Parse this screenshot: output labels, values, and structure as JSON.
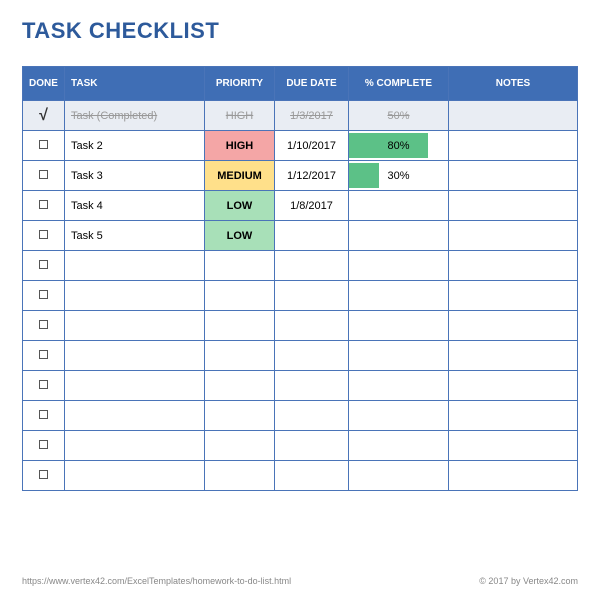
{
  "title": "TASK CHECKLIST",
  "columns": {
    "done": "DONE",
    "task": "TASK",
    "priority": "PRIORITY",
    "due": "DUE DATE",
    "complete": "% COMPLETE",
    "notes": "NOTES"
  },
  "rows": [
    {
      "done": true,
      "task": "Task (Completed)",
      "priority": "HIGH",
      "due": "1/3/2017",
      "pct": "50%",
      "pct_num": 50,
      "notes": "",
      "completed": true
    },
    {
      "done": false,
      "task": "Task 2",
      "priority": "HIGH",
      "due": "1/10/2017",
      "pct": "80%",
      "pct_num": 80,
      "notes": "",
      "completed": false
    },
    {
      "done": false,
      "task": "Task 3",
      "priority": "MEDIUM",
      "due": "1/12/2017",
      "pct": "30%",
      "pct_num": 30,
      "notes": "",
      "completed": false
    },
    {
      "done": false,
      "task": "Task 4",
      "priority": "LOW",
      "due": "1/8/2017",
      "pct": "",
      "pct_num": null,
      "notes": "",
      "completed": false
    },
    {
      "done": false,
      "task": "Task 5",
      "priority": "LOW",
      "due": "",
      "pct": "",
      "pct_num": null,
      "notes": "",
      "completed": false
    },
    {
      "done": false,
      "task": "",
      "priority": "",
      "due": "",
      "pct": "",
      "pct_num": null,
      "notes": "",
      "completed": false
    },
    {
      "done": false,
      "task": "",
      "priority": "",
      "due": "",
      "pct": "",
      "pct_num": null,
      "notes": "",
      "completed": false
    },
    {
      "done": false,
      "task": "",
      "priority": "",
      "due": "",
      "pct": "",
      "pct_num": null,
      "notes": "",
      "completed": false
    },
    {
      "done": false,
      "task": "",
      "priority": "",
      "due": "",
      "pct": "",
      "pct_num": null,
      "notes": "",
      "completed": false
    },
    {
      "done": false,
      "task": "",
      "priority": "",
      "due": "",
      "pct": "",
      "pct_num": null,
      "notes": "",
      "completed": false
    },
    {
      "done": false,
      "task": "",
      "priority": "",
      "due": "",
      "pct": "",
      "pct_num": null,
      "notes": "",
      "completed": false
    },
    {
      "done": false,
      "task": "",
      "priority": "",
      "due": "",
      "pct": "",
      "pct_num": null,
      "notes": "",
      "completed": false
    },
    {
      "done": false,
      "task": "",
      "priority": "",
      "due": "",
      "pct": "",
      "pct_num": null,
      "notes": "",
      "completed": false
    }
  ],
  "priority_classes": {
    "HIGH": "prio-high",
    "MEDIUM": "prio-medium",
    "LOW": "prio-low"
  },
  "footer": {
    "url": "https://www.vertex42.com/ExcelTemplates/homework-to-do-list.html",
    "copyright": "© 2017 by Vertex42.com"
  }
}
